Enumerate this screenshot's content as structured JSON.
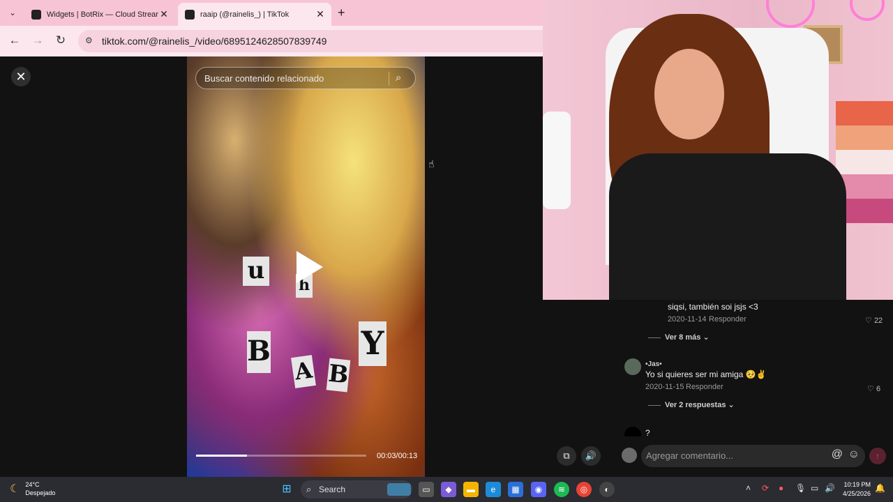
{
  "browser": {
    "tabs": [
      {
        "label": "Widgets | BotRix — Cloud Streaming Bot fo",
        "active": false
      },
      {
        "label": "raaip (@rainelis_) | TikTok",
        "active": true
      }
    ],
    "url": "tiktok.com/@rainelis_/video/6895124628507839749"
  },
  "video": {
    "search_placeholder": "Buscar contenido relacionado",
    "overlay_letters": [
      "u",
      "h",
      "B",
      "A",
      "B",
      "Y"
    ],
    "time": "00:03/00:13",
    "progress": 0.3
  },
  "comments": [
    {
      "text": "siqsi, también soi jsjs <3",
      "date": "2020-11-14",
      "reply": "Responder",
      "likes": "22",
      "more": "Ver 8 más"
    },
    {
      "name": "•Jas•",
      "text": "Yo si quieres ser mi amiga 🥺✌️",
      "date": "2020-11-15",
      "reply": "Responder",
      "likes": "6",
      "more": "Ver 2 respuestas"
    },
    {
      "text": "?"
    }
  ],
  "comment_input": {
    "placeholder": "Agregar comentario..."
  },
  "taskbar": {
    "temperature": "24°C",
    "weather": "Despejado",
    "search_label": "Search",
    "time": "10:19 PM",
    "date": "4/25/2026"
  },
  "colors": {
    "tab_bar": "#f7c4d6",
    "accent_send": "#ff3b5c",
    "taskbar": "#2b2b32"
  }
}
